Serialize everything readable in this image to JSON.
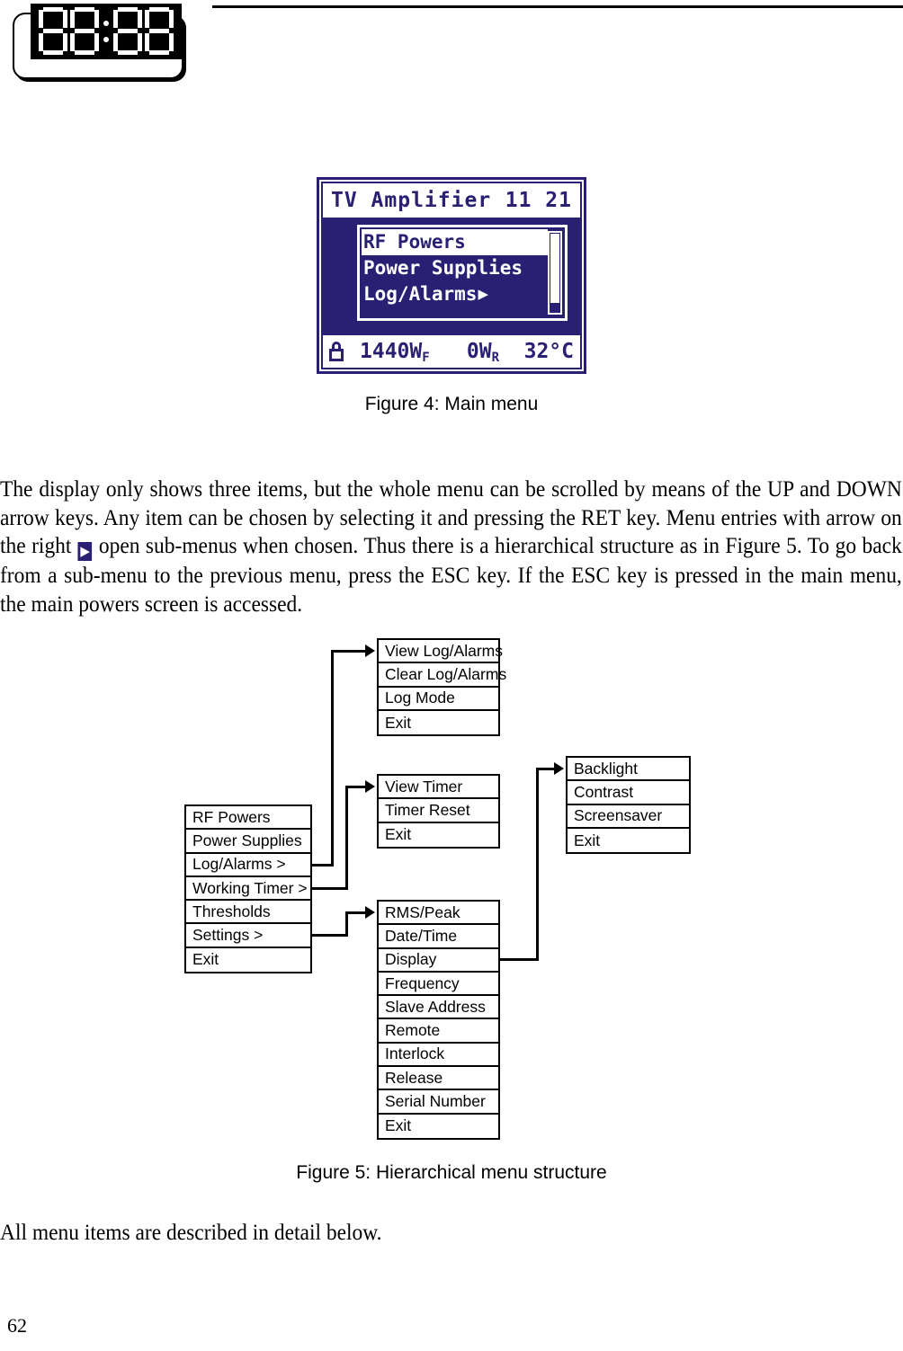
{
  "page": {
    "number": "62"
  },
  "logo": {
    "display_text": "88:88",
    "digits": [
      "8",
      "8",
      "8",
      "8"
    ]
  },
  "figure4": {
    "caption": "Figure 4: Main menu",
    "lcd": {
      "title": "TV Amplifier",
      "clock": "11 21",
      "menu_items": [
        {
          "label": "RF Powers",
          "selected": true,
          "has_submenu": false
        },
        {
          "label": "Power Supplies",
          "selected": false,
          "has_submenu": false
        },
        {
          "label": "Log/Alarms",
          "selected": false,
          "has_submenu": true
        }
      ],
      "submenu_arrow_glyph": "▶",
      "status": {
        "lock_icon": "padlock-icon",
        "forward_power": "1440W",
        "forward_power_subscript": "F",
        "reflected_power": "0W",
        "reflected_power_subscript": "R",
        "temperature": "32°C"
      },
      "colors": {
        "lcd_blue": "#2a2073",
        "lcd_white": "#ffffff"
      }
    }
  },
  "paragraphs": {
    "intro_part1": "The display only shows three items, but the whole menu can be scrolled by means of the UP and DOWN arrow keys. Any item can be chosen by selecting it and pressing the RET key. Menu entries with arrow on the right",
    "intro_arrow": "▶",
    "intro_part2": "open sub-menus when chosen. Thus there is a hierarchical structure as in Figure 5. To go back from a sub-menu to the previous menu, press the ESC key. If the ESC key is pressed in the main menu, the main powers screen is accessed.",
    "closing": "All menu items are described in detail below."
  },
  "figure5": {
    "caption": "Figure 5: Hierarchical menu structure",
    "boxes": {
      "main_menu": {
        "name": "Main menu",
        "items": [
          "RF Powers",
          "Power Supplies",
          "Log/Alarms >",
          "Working Timer >",
          "Thresholds",
          "Settings >",
          "Exit"
        ]
      },
      "log_alarms": {
        "name": "Log/Alarms submenu",
        "items": [
          "View Log/Alarms",
          "Clear Log/Alarms",
          "Log Mode",
          "Exit"
        ]
      },
      "working_timer": {
        "name": "Working Timer submenu",
        "items": [
          "View Timer",
          "Timer Reset",
          "Exit"
        ]
      },
      "settings": {
        "name": "Settings submenu",
        "items": [
          "RMS/Peak",
          "Date/Time",
          "Display",
          "Frequency",
          "Slave Address",
          "Remote",
          "Interlock",
          "Release",
          "Serial Number",
          "Exit"
        ]
      },
      "display": {
        "name": "Display submenu",
        "items": [
          "Backlight",
          "Contrast",
          "Screensaver",
          "Exit"
        ]
      }
    }
  }
}
